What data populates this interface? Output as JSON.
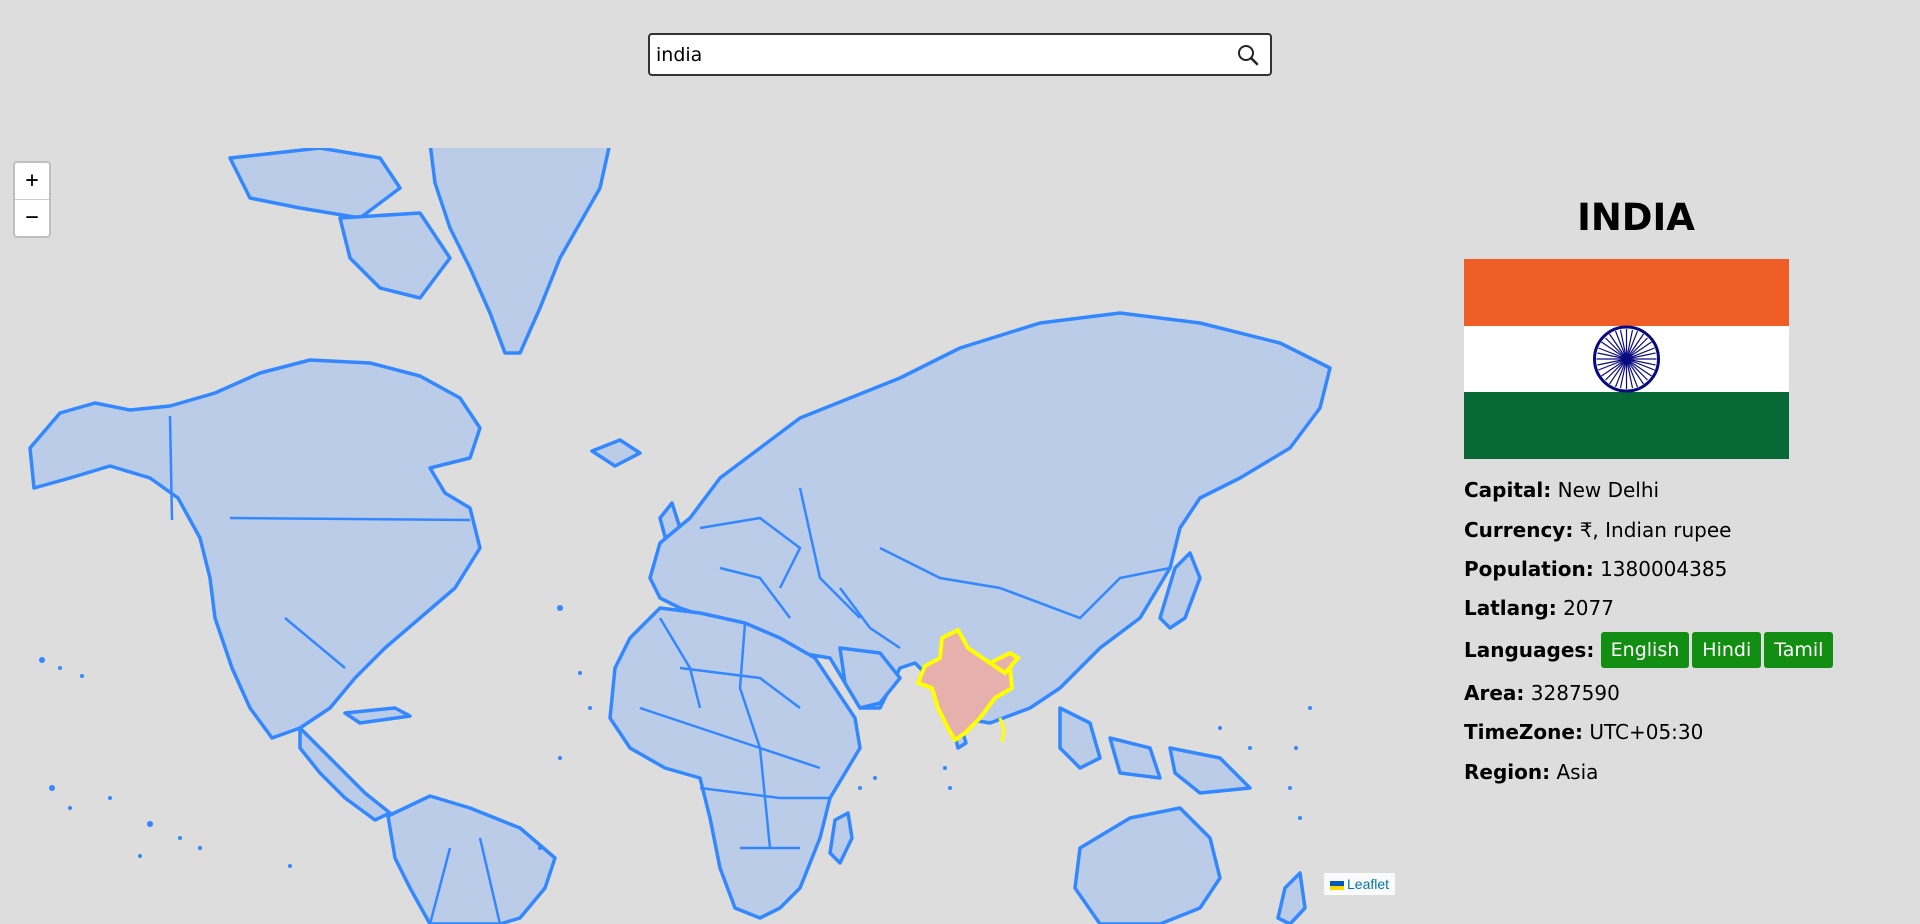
{
  "search": {
    "value": "india",
    "placeholder": "",
    "icon": "search-icon"
  },
  "map": {
    "zoom_in_label": "+",
    "zoom_out_label": "−",
    "attribution": "Leaflet",
    "land_color": "#bbcce8",
    "border_color": "#3388ff",
    "highlight_fill": "#e6b0ad",
    "highlight_border": "#ffff00"
  },
  "country": {
    "name": "INDIA",
    "flag": {
      "colors": [
        "#f05e28",
        "#ffffff",
        "#066936"
      ],
      "chakra_color": "#0a0a80"
    },
    "capital_label": "Capital:",
    "capital": "New Delhi",
    "currency_label": "Currency:",
    "currency": "₹, Indian rupee",
    "population_label": "Population:",
    "population": "1380004385",
    "latlang_label": "Latlang:",
    "latlang": "2077",
    "languages_label": "Languages:",
    "languages": [
      "English",
      "Hindi",
      "Tamil"
    ],
    "area_label": "Area:",
    "area": "3287590",
    "timezone_label": "TimeZone:",
    "timezone": "UTC+05:30",
    "region_label": "Region:",
    "region": "Asia"
  }
}
